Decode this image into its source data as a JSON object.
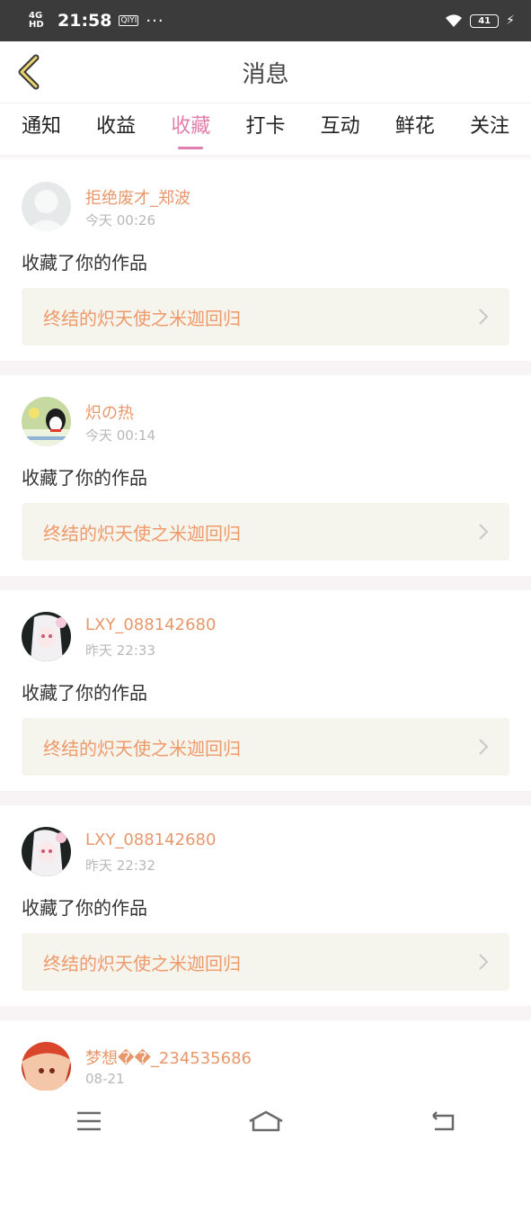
{
  "statusbar": {
    "network": "4G HD",
    "time": "21:58",
    "app_badge": "QIYI",
    "dots": "···",
    "battery": "41"
  },
  "header": {
    "title": "消息"
  },
  "tabs": [
    {
      "label": "通知",
      "active": false
    },
    {
      "label": "收益",
      "active": false
    },
    {
      "label": "收藏",
      "active": true
    },
    {
      "label": "打卡",
      "active": false
    },
    {
      "label": "互动",
      "active": false
    },
    {
      "label": "鲜花",
      "active": false
    },
    {
      "label": "关注",
      "active": false
    }
  ],
  "items": [
    {
      "username": "拒绝废才_郑波",
      "time": "今天 00:26",
      "action": "收藏了你的作品",
      "work": "终结的炽天使之米迦回归",
      "avatar": "default-avatar"
    },
    {
      "username": "炽の热",
      "time": "今天 00:14",
      "action": "收藏了你的作品",
      "work": "终结的炽天使之米迦回归",
      "avatar": "penguin-avatar"
    },
    {
      "username": "LXY_088142680",
      "time": "昨天 22:33",
      "action": "收藏了你的作品",
      "work": "终结的炽天使之米迦回归",
      "avatar": "anime-girl-avatar"
    },
    {
      "username": "LXY_088142680",
      "time": "昨天 22:32",
      "action": "收藏了你的作品",
      "work": "终结的炽天使之米迦回归",
      "avatar": "anime-girl-avatar"
    },
    {
      "username": "梦想��_234535686",
      "time": "08-21",
      "action": "",
      "work": "",
      "avatar": "anime-red-avatar"
    }
  ],
  "colors": {
    "accent": "#e27fae",
    "username": "#e8976a",
    "work_title": "#ee9a6a",
    "work_bg": "#f5f4ed",
    "statusbar_bg": "#3b3b3b"
  },
  "navbar": [
    "menu-icon",
    "home-icon",
    "back-icon"
  ]
}
